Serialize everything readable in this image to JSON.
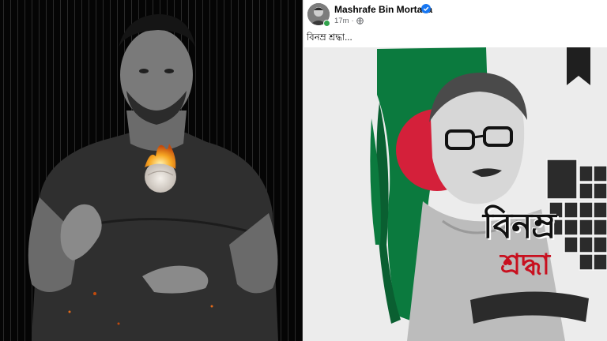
{
  "left_photo": {
    "description_icon": "person-holding-burning-ball",
    "colors": {
      "background": "#050505",
      "flame": "#f7a823"
    }
  },
  "post": {
    "author": "Mashrafe Bin Mortaza",
    "verified": true,
    "time": "17m",
    "audience_icon": "globe-icon",
    "caption": "বিনম্র শ্রদ্ধা...",
    "image": {
      "title_text": "বিনম্র",
      "subtitle_text": "শ্রদ্ধা",
      "mourning_ribbon": true,
      "colors": {
        "flag_green": "#0b7a3e",
        "flag_red": "#d4203a",
        "ribbon": "#1f1f1f",
        "subtitle": "#c8101f",
        "background": "#ececec"
      }
    }
  }
}
